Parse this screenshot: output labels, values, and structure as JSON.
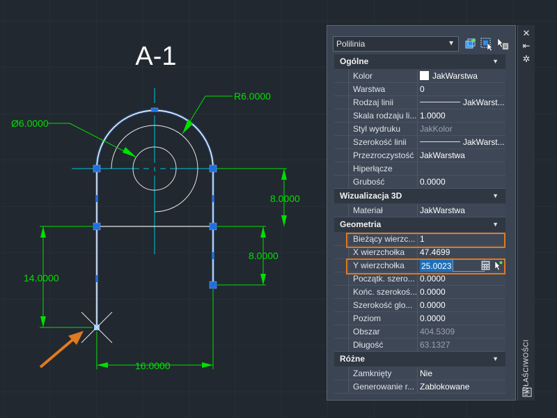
{
  "drawing": {
    "title": "A-1",
    "dimensions": {
      "radius": "R6.0000",
      "diameter": "Ø6.0000",
      "right_upper": "8.0000",
      "right_lower": "8.0000",
      "left_height": "14.0000",
      "bottom_width": "16.0000"
    },
    "colors": {
      "background": "#212830",
      "grid": "#2c343d",
      "dimension": "#00e000",
      "centerline": "#00c8d8",
      "object": "#e6e6e6",
      "grip": "#1e6fe0",
      "highlight": "#e07a1f"
    }
  },
  "palette": {
    "title": "WŁAŚCIWOŚCI",
    "object_type": "Polilinia",
    "toolbar_icons": [
      "quick-select-icon",
      "select-objects-icon",
      "toggle-pickadd-icon"
    ],
    "side_icons": [
      "close-icon",
      "auto-hide-icon",
      "settings-icon"
    ],
    "sections": {
      "general": {
        "title": "Ogólne",
        "rows": [
          {
            "name": "Kolor",
            "value": "JakWarstwa"
          },
          {
            "name": "Warstwa",
            "value": "0"
          },
          {
            "name": "Rodzaj linii",
            "value": "JakWarst..."
          },
          {
            "name": "Skala rodzaju li...",
            "value": "1.0000"
          },
          {
            "name": "Styl wydruku",
            "value": "JakKolor"
          },
          {
            "name": "Szerokość linii",
            "value": "JakWarst..."
          },
          {
            "name": "Przezroczystość",
            "value": "JakWarstwa"
          },
          {
            "name": "Hiperłącze",
            "value": ""
          },
          {
            "name": "Grubość",
            "value": "0.0000"
          }
        ]
      },
      "visualization": {
        "title": "Wizualizacja 3D",
        "rows": [
          {
            "name": "Materiał",
            "value": "JakWarstwa"
          }
        ]
      },
      "geometry": {
        "title": "Geometria",
        "rows": [
          {
            "name": "Bieżący wierzc...",
            "value": "1"
          },
          {
            "name": "X wierzchołka",
            "value": "47.4699"
          },
          {
            "name": "Y wierzchołka",
            "value": "25.0023"
          },
          {
            "name": "Początk. szero...",
            "value": "0.0000"
          },
          {
            "name": "Końc. szerokoś...",
            "value": "0.0000"
          },
          {
            "name": "Szerokość glo...",
            "value": "0.0000"
          },
          {
            "name": "Poziom",
            "value": "0.0000"
          },
          {
            "name": "Obszar",
            "value": "404.5309"
          },
          {
            "name": "Długość",
            "value": "63.1327"
          }
        ]
      },
      "misc": {
        "title": "Różne",
        "rows": [
          {
            "name": "Zamknięty",
            "value": "Nie"
          },
          {
            "name": "Generowanie r...",
            "value": "Zablokowane"
          }
        ]
      }
    }
  }
}
